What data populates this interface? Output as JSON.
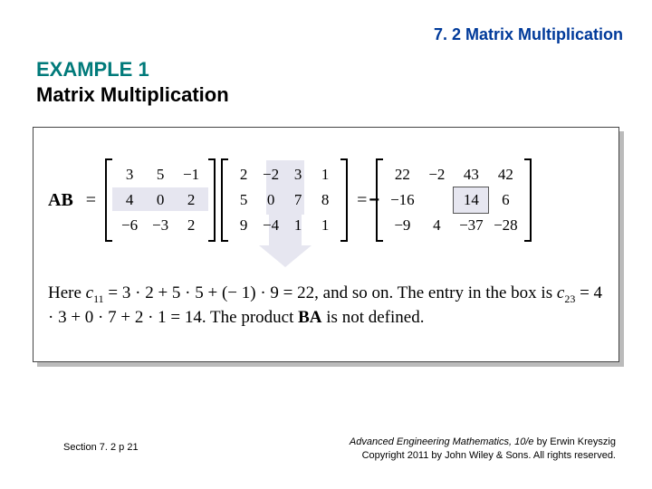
{
  "header": "7. 2 Matrix Multiplication",
  "example_label": "EXAMPLE 1",
  "example_title": "Matrix Multiplication",
  "equation": {
    "lhs": "AB",
    "eq": "=",
    "matrixA": [
      [
        "3",
        "5",
        "−1"
      ],
      [
        "4",
        "0",
        "2"
      ],
      [
        "−6",
        "−3",
        "2"
      ]
    ],
    "matrixB": [
      [
        "2",
        "−2",
        "3",
        "1"
      ],
      [
        "5",
        "0",
        "7",
        "8"
      ],
      [
        "9",
        "−4",
        "1",
        "1"
      ]
    ],
    "matrixC": [
      [
        "22",
        "−2",
        "43",
        "42"
      ],
      [
        "−16",
        "14",
        "6"
      ],
      [
        "−9",
        "4",
        "−37",
        "−28"
      ]
    ],
    "neg_overlay": "−",
    "boxed_value": "14"
  },
  "explanation": {
    "pre": "Here ",
    "c11": "c",
    "sub11": "11",
    "mid1": " = 3 · 2 + 5 · 5 + (− 1) · 9 = 22, and so on. The entry in the box is ",
    "c23": "c",
    "sub23": "23",
    "mid2": " = 4 · 3 + 0 · 7 + 2 · 1 = 14. The product ",
    "ba": "BA",
    "tail": " is not defined."
  },
  "footer": {
    "left": "Section 7. 2  p 21",
    "right_title": "Advanced Engineering Mathematics, 10/e",
    "right_author": " by Erwin Kreyszig",
    "right_copyright": "Copyright 2011 by John Wiley & Sons. All rights reserved."
  }
}
